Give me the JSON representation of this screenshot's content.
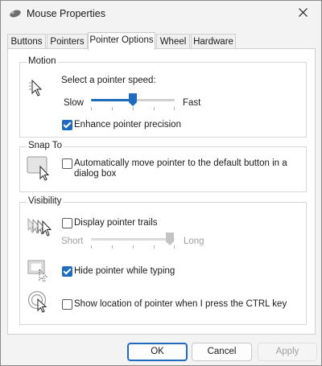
{
  "window": {
    "title": "Mouse Properties"
  },
  "tabs": [
    {
      "label": "Buttons"
    },
    {
      "label": "Pointers"
    },
    {
      "label": "Pointer Options"
    },
    {
      "label": "Wheel"
    },
    {
      "label": "Hardware"
    }
  ],
  "active_tab": "Pointer Options",
  "motion": {
    "group_label": "Motion",
    "speed_label": "Select a pointer speed:",
    "slow_label": "Slow",
    "fast_label": "Fast",
    "speed_value": 0.5,
    "enhance_label": "Enhance pointer precision",
    "enhance_checked": true
  },
  "snap_to": {
    "group_label": "Snap To",
    "auto_move_label_line1": "Automatically move pointer to the default button in a",
    "auto_move_label_line2": "dialog box",
    "auto_move_checked": false
  },
  "visibility": {
    "group_label": "Visibility",
    "trails_label": "Display pointer trails",
    "trails_checked": false,
    "short_label": "Short",
    "long_label": "Long",
    "trails_value": 1.0,
    "hide_typing_label": "Hide pointer while typing",
    "hide_typing_checked": true,
    "show_location_label": "Show location of pointer when I press the CTRL key",
    "show_location_checked": false
  },
  "buttons": {
    "ok": "OK",
    "cancel": "Cancel",
    "apply": "Apply"
  },
  "colors": {
    "accent": "#1f6cbf"
  },
  "icons": [
    "mouse-icon",
    "close-icon",
    "pointer-speed-icon",
    "snap-to-icon",
    "pointer-trails-icon",
    "hide-pointer-icon",
    "pointer-location-icon"
  ]
}
